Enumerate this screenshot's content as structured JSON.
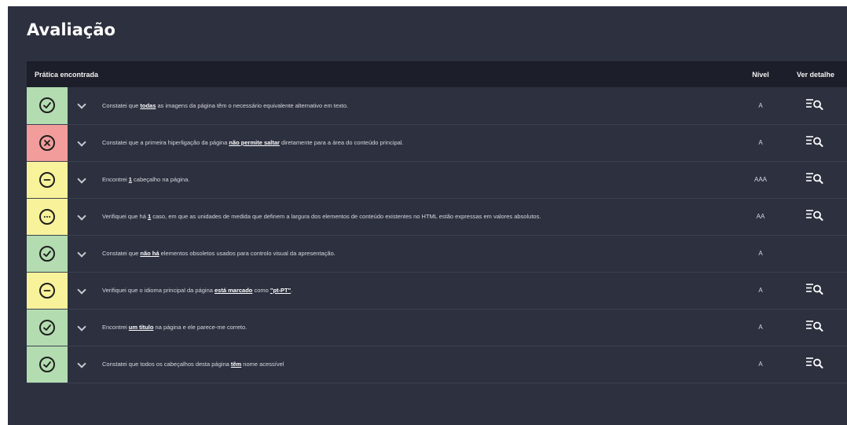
{
  "title": "Avaliação",
  "table": {
    "headers": {
      "practice": "Prática encontrada",
      "level": "Nível",
      "detail": "Ver detalhe"
    },
    "rows": [
      {
        "status": "pass",
        "icon": "check-circle-icon",
        "parts": [
          "Constatei que ",
          "todas",
          " as imagens da página têm o necessário equivalente alternativo em texto."
        ],
        "level": "A",
        "detail": true
      },
      {
        "status": "fail",
        "icon": "x-circle-icon",
        "parts": [
          "Constatei que a primeira hiperligação da página ",
          "não permite saltar",
          " diretamente para a área do conteúdo principal."
        ],
        "level": "A",
        "detail": true
      },
      {
        "status": "warn",
        "icon": "minus-circle-icon",
        "parts": [
          "Encontrei ",
          "1",
          " cabeçalho na página."
        ],
        "level": "AAA",
        "detail": true
      },
      {
        "status": "warn",
        "icon": "ellipsis-circle-icon",
        "parts": [
          "Verifiquei que há ",
          "1",
          " caso, em que as unidades de medida que definem a largura dos elementos de conteúdo existentes no HTML estão expressas em valores absolutos."
        ],
        "level": "AA",
        "detail": true
      },
      {
        "status": "pass",
        "icon": "check-circle-icon",
        "parts": [
          "Constatei que ",
          "não há",
          " elementos obsoletos usados para controlo visual da apresentação."
        ],
        "level": "A",
        "detail": false
      },
      {
        "status": "warn",
        "icon": "minus-circle-icon",
        "parts": [
          "Verifiquei que o idioma principal da página ",
          "está marcado",
          " como ",
          "\"pt-PT\"",
          "."
        ],
        "level": "A",
        "detail": true
      },
      {
        "status": "pass",
        "icon": "check-circle-icon",
        "parts": [
          "Encontrei ",
          "um título",
          " na página e ele parece-me correto."
        ],
        "level": "A",
        "detail": true
      },
      {
        "status": "pass",
        "icon": "check-circle-icon",
        "parts": [
          "Constatei que todos os cabeçalhos desta página ",
          "têm",
          " nome acessível"
        ],
        "level": "A",
        "detail": true
      }
    ]
  },
  "colors": {
    "pass": "#b3dcb0",
    "fail": "#f29c9c",
    "warn": "#f8f29a",
    "panel": "#2c303f",
    "header": "#1c1f2a"
  }
}
